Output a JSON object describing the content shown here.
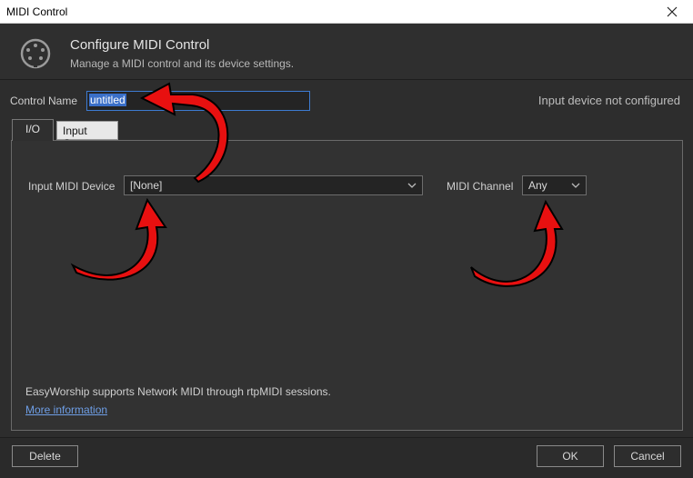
{
  "window": {
    "title": "MIDI Control"
  },
  "header": {
    "title": "Configure MIDI Control",
    "subtitle": "Manage a MIDI control and its device settings."
  },
  "form": {
    "control_name_label": "Control Name",
    "control_name_value": "untitled",
    "status": "Input device not configured"
  },
  "tabs": [
    {
      "label": "I/O",
      "active": true
    },
    {
      "label": "Input Cues",
      "active": false
    }
  ],
  "io": {
    "device_label": "Input MIDI Device",
    "device_value": "[None]",
    "channel_label": "MIDI Channel",
    "channel_value": "Any",
    "note": "EasyWorship supports Network MIDI through rtpMIDI sessions.",
    "more_link": "More information"
  },
  "buttons": {
    "delete": "Delete",
    "ok": "OK",
    "cancel": "Cancel"
  },
  "colors": {
    "background": "#2d2d2d",
    "accent": "#3d7bd1",
    "link": "#6e9ee6",
    "annotation_arrow": "#e81010"
  }
}
